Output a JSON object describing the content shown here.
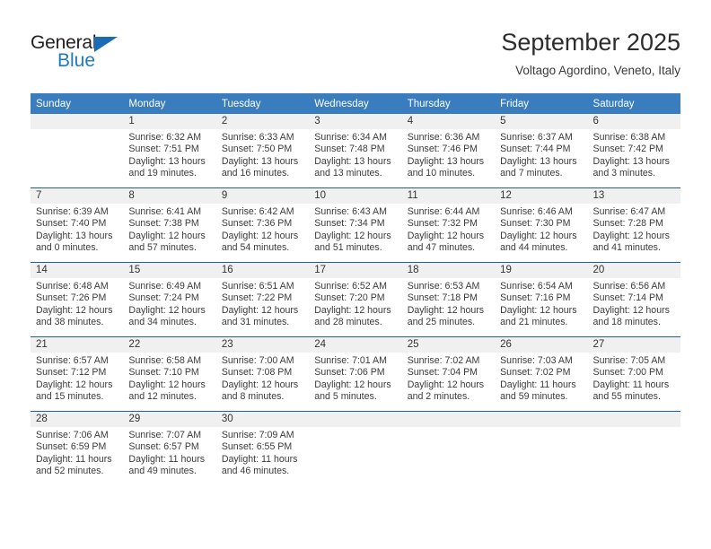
{
  "brand": {
    "name_top": "General",
    "name_bottom": "Blue",
    "color_top": "#231f20",
    "color_bottom": "#1f7bc1",
    "triangle_color": "#1a6cb5"
  },
  "header": {
    "title": "September 2025",
    "location": "Voltago Agordino, Veneto, Italy"
  },
  "theme": {
    "header_row_bg": "#3a7dbf",
    "header_row_text": "#ffffff",
    "row_divider": "#1f5fa0",
    "daynum_band_bg": "#f0f0f0",
    "page_bg": "#ffffff",
    "body_text": "#3b3b3b"
  },
  "weekday_headers": [
    "Sunday",
    "Monday",
    "Tuesday",
    "Wednesday",
    "Thursday",
    "Friday",
    "Saturday"
  ],
  "weeks": [
    [
      {
        "day": "",
        "sunrise": "",
        "sunset": "",
        "daylight_line1": "",
        "daylight_line2": ""
      },
      {
        "day": "1",
        "sunrise": "Sunrise: 6:32 AM",
        "sunset": "Sunset: 7:51 PM",
        "daylight_line1": "Daylight: 13 hours",
        "daylight_line2": "and 19 minutes."
      },
      {
        "day": "2",
        "sunrise": "Sunrise: 6:33 AM",
        "sunset": "Sunset: 7:50 PM",
        "daylight_line1": "Daylight: 13 hours",
        "daylight_line2": "and 16 minutes."
      },
      {
        "day": "3",
        "sunrise": "Sunrise: 6:34 AM",
        "sunset": "Sunset: 7:48 PM",
        "daylight_line1": "Daylight: 13 hours",
        "daylight_line2": "and 13 minutes."
      },
      {
        "day": "4",
        "sunrise": "Sunrise: 6:36 AM",
        "sunset": "Sunset: 7:46 PM",
        "daylight_line1": "Daylight: 13 hours",
        "daylight_line2": "and 10 minutes."
      },
      {
        "day": "5",
        "sunrise": "Sunrise: 6:37 AM",
        "sunset": "Sunset: 7:44 PM",
        "daylight_line1": "Daylight: 13 hours",
        "daylight_line2": "and 7 minutes."
      },
      {
        "day": "6",
        "sunrise": "Sunrise: 6:38 AM",
        "sunset": "Sunset: 7:42 PM",
        "daylight_line1": "Daylight: 13 hours",
        "daylight_line2": "and 3 minutes."
      }
    ],
    [
      {
        "day": "7",
        "sunrise": "Sunrise: 6:39 AM",
        "sunset": "Sunset: 7:40 PM",
        "daylight_line1": "Daylight: 13 hours",
        "daylight_line2": "and 0 minutes."
      },
      {
        "day": "8",
        "sunrise": "Sunrise: 6:41 AM",
        "sunset": "Sunset: 7:38 PM",
        "daylight_line1": "Daylight: 12 hours",
        "daylight_line2": "and 57 minutes."
      },
      {
        "day": "9",
        "sunrise": "Sunrise: 6:42 AM",
        "sunset": "Sunset: 7:36 PM",
        "daylight_line1": "Daylight: 12 hours",
        "daylight_line2": "and 54 minutes."
      },
      {
        "day": "10",
        "sunrise": "Sunrise: 6:43 AM",
        "sunset": "Sunset: 7:34 PM",
        "daylight_line1": "Daylight: 12 hours",
        "daylight_line2": "and 51 minutes."
      },
      {
        "day": "11",
        "sunrise": "Sunrise: 6:44 AM",
        "sunset": "Sunset: 7:32 PM",
        "daylight_line1": "Daylight: 12 hours",
        "daylight_line2": "and 47 minutes."
      },
      {
        "day": "12",
        "sunrise": "Sunrise: 6:46 AM",
        "sunset": "Sunset: 7:30 PM",
        "daylight_line1": "Daylight: 12 hours",
        "daylight_line2": "and 44 minutes."
      },
      {
        "day": "13",
        "sunrise": "Sunrise: 6:47 AM",
        "sunset": "Sunset: 7:28 PM",
        "daylight_line1": "Daylight: 12 hours",
        "daylight_line2": "and 41 minutes."
      }
    ],
    [
      {
        "day": "14",
        "sunrise": "Sunrise: 6:48 AM",
        "sunset": "Sunset: 7:26 PM",
        "daylight_line1": "Daylight: 12 hours",
        "daylight_line2": "and 38 minutes."
      },
      {
        "day": "15",
        "sunrise": "Sunrise: 6:49 AM",
        "sunset": "Sunset: 7:24 PM",
        "daylight_line1": "Daylight: 12 hours",
        "daylight_line2": "and 34 minutes."
      },
      {
        "day": "16",
        "sunrise": "Sunrise: 6:51 AM",
        "sunset": "Sunset: 7:22 PM",
        "daylight_line1": "Daylight: 12 hours",
        "daylight_line2": "and 31 minutes."
      },
      {
        "day": "17",
        "sunrise": "Sunrise: 6:52 AM",
        "sunset": "Sunset: 7:20 PM",
        "daylight_line1": "Daylight: 12 hours",
        "daylight_line2": "and 28 minutes."
      },
      {
        "day": "18",
        "sunrise": "Sunrise: 6:53 AM",
        "sunset": "Sunset: 7:18 PM",
        "daylight_line1": "Daylight: 12 hours",
        "daylight_line2": "and 25 minutes."
      },
      {
        "day": "19",
        "sunrise": "Sunrise: 6:54 AM",
        "sunset": "Sunset: 7:16 PM",
        "daylight_line1": "Daylight: 12 hours",
        "daylight_line2": "and 21 minutes."
      },
      {
        "day": "20",
        "sunrise": "Sunrise: 6:56 AM",
        "sunset": "Sunset: 7:14 PM",
        "daylight_line1": "Daylight: 12 hours",
        "daylight_line2": "and 18 minutes."
      }
    ],
    [
      {
        "day": "21",
        "sunrise": "Sunrise: 6:57 AM",
        "sunset": "Sunset: 7:12 PM",
        "daylight_line1": "Daylight: 12 hours",
        "daylight_line2": "and 15 minutes."
      },
      {
        "day": "22",
        "sunrise": "Sunrise: 6:58 AM",
        "sunset": "Sunset: 7:10 PM",
        "daylight_line1": "Daylight: 12 hours",
        "daylight_line2": "and 12 minutes."
      },
      {
        "day": "23",
        "sunrise": "Sunrise: 7:00 AM",
        "sunset": "Sunset: 7:08 PM",
        "daylight_line1": "Daylight: 12 hours",
        "daylight_line2": "and 8 minutes."
      },
      {
        "day": "24",
        "sunrise": "Sunrise: 7:01 AM",
        "sunset": "Sunset: 7:06 PM",
        "daylight_line1": "Daylight: 12 hours",
        "daylight_line2": "and 5 minutes."
      },
      {
        "day": "25",
        "sunrise": "Sunrise: 7:02 AM",
        "sunset": "Sunset: 7:04 PM",
        "daylight_line1": "Daylight: 12 hours",
        "daylight_line2": "and 2 minutes."
      },
      {
        "day": "26",
        "sunrise": "Sunrise: 7:03 AM",
        "sunset": "Sunset: 7:02 PM",
        "daylight_line1": "Daylight: 11 hours",
        "daylight_line2": "and 59 minutes."
      },
      {
        "day": "27",
        "sunrise": "Sunrise: 7:05 AM",
        "sunset": "Sunset: 7:00 PM",
        "daylight_line1": "Daylight: 11 hours",
        "daylight_line2": "and 55 minutes."
      }
    ],
    [
      {
        "day": "28",
        "sunrise": "Sunrise: 7:06 AM",
        "sunset": "Sunset: 6:59 PM",
        "daylight_line1": "Daylight: 11 hours",
        "daylight_line2": "and 52 minutes."
      },
      {
        "day": "29",
        "sunrise": "Sunrise: 7:07 AM",
        "sunset": "Sunset: 6:57 PM",
        "daylight_line1": "Daylight: 11 hours",
        "daylight_line2": "and 49 minutes."
      },
      {
        "day": "30",
        "sunrise": "Sunrise: 7:09 AM",
        "sunset": "Sunset: 6:55 PM",
        "daylight_line1": "Daylight: 11 hours",
        "daylight_line2": "and 46 minutes."
      },
      {
        "day": "",
        "sunrise": "",
        "sunset": "",
        "daylight_line1": "",
        "daylight_line2": ""
      },
      {
        "day": "",
        "sunrise": "",
        "sunset": "",
        "daylight_line1": "",
        "daylight_line2": ""
      },
      {
        "day": "",
        "sunrise": "",
        "sunset": "",
        "daylight_line1": "",
        "daylight_line2": ""
      },
      {
        "day": "",
        "sunrise": "",
        "sunset": "",
        "daylight_line1": "",
        "daylight_line2": ""
      }
    ]
  ]
}
